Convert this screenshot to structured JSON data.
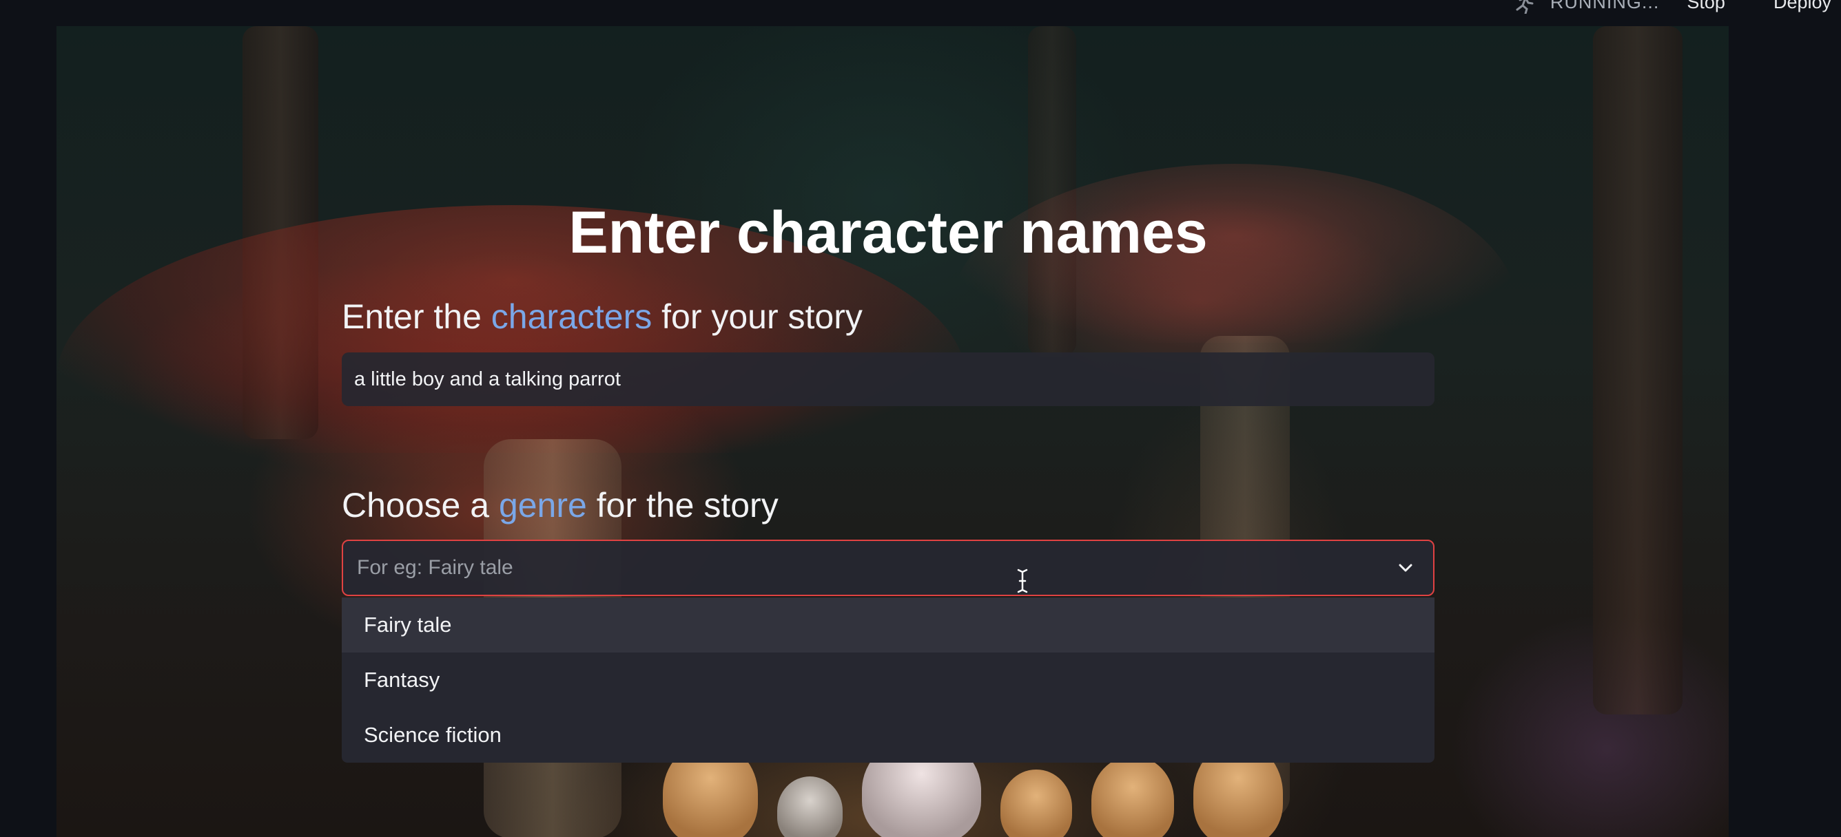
{
  "topbar": {
    "status_label": "RUNNING...",
    "stop_label": "Stop",
    "deploy_label": "Deploy",
    "status_icon": "running-figure-icon"
  },
  "main": {
    "title": "Enter character names",
    "characters_section": {
      "label_prefix": "Enter the ",
      "label_accent": "characters",
      "label_suffix": " for your story",
      "input_value": "a little boy and a talking parrot"
    },
    "genre_section": {
      "label_prefix": "Choose a ",
      "label_accent": "genre",
      "label_suffix": " for the story",
      "placeholder": "For eg: Fairy tale",
      "options": [
        "Fairy tale",
        "Fantasy",
        "Science fiction"
      ],
      "highlighted_option": "Fairy tale"
    }
  },
  "colors": {
    "accent": "#7aa7e8",
    "focus_border": "#e04242",
    "input_bg": "#262730",
    "app_bg": "#0e1117"
  }
}
